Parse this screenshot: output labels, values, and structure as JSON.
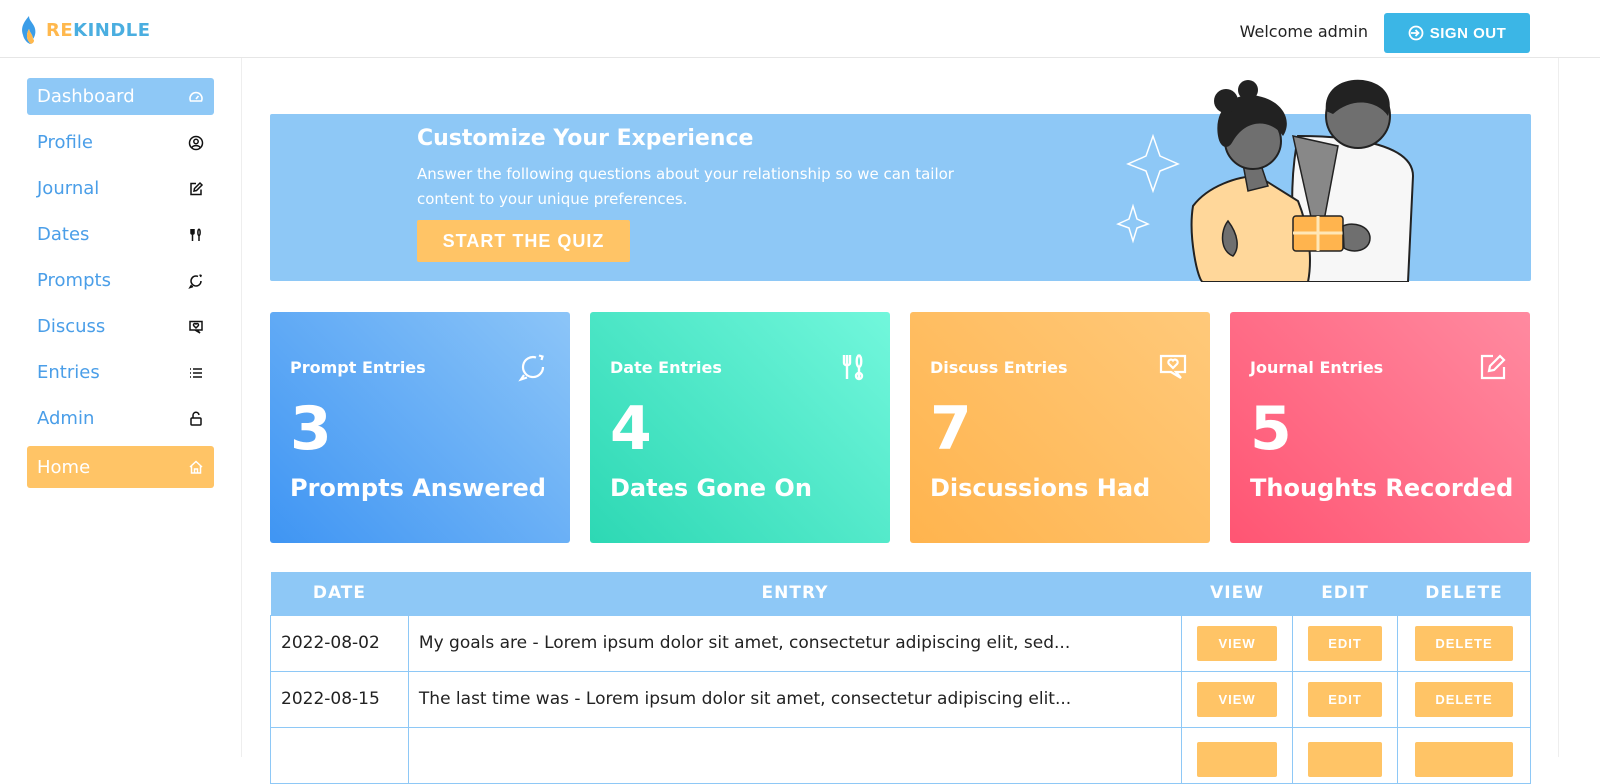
{
  "app": {
    "brand_re": "RE",
    "brand_rest": "KINDLE"
  },
  "header": {
    "welcome": "Welcome admin",
    "signout": "SIGN OUT"
  },
  "sidebar": {
    "items": [
      {
        "label": "Dashboard",
        "icon": "gauge-icon",
        "state": "active"
      },
      {
        "label": "Profile",
        "icon": "user-circle-icon"
      },
      {
        "label": "Journal",
        "icon": "edit-icon"
      },
      {
        "label": "Dates",
        "icon": "utensils-icon"
      },
      {
        "label": "Prompts",
        "icon": "chat-refresh-icon"
      },
      {
        "label": "Discuss",
        "icon": "chat-heart-icon"
      },
      {
        "label": "Entries",
        "icon": "list-icon"
      },
      {
        "label": "Admin",
        "icon": "lock-icon"
      },
      {
        "label": "Home",
        "icon": "home-icon",
        "state": "home"
      }
    ]
  },
  "banner": {
    "title": "Customize Your Experience",
    "text": "Answer the following questions about your relationship so we can tailor content to your unique preferences.",
    "button": "START THE QUIZ"
  },
  "cards": [
    {
      "title": "Prompt Entries",
      "value": "3",
      "subtitle": "Prompts Answered",
      "icon": "chat-refresh-icon"
    },
    {
      "title": "Date Entries",
      "value": "4",
      "subtitle": "Dates Gone On",
      "icon": "utensils-icon"
    },
    {
      "title": "Discuss Entries",
      "value": "7",
      "subtitle": "Discussions Had",
      "icon": "chat-heart-icon"
    },
    {
      "title": "Journal Entries",
      "value": "5",
      "subtitle": "Thoughts Recorded",
      "icon": "edit-icon"
    }
  ],
  "table": {
    "headers": [
      "DATE",
      "ENTRY",
      "VIEW",
      "EDIT",
      "DELETE"
    ],
    "rows": [
      {
        "date": "2022-08-02",
        "entry": "My goals are - Lorem ipsum dolor sit amet, consectetur adipiscing elit, sed...",
        "view": "VIEW",
        "edit": "EDIT",
        "delete": "DELETE"
      },
      {
        "date": "2022-08-15",
        "entry": "The last time was - Lorem ipsum dolor sit amet, consectetur adipiscing elit...",
        "view": "VIEW",
        "edit": "EDIT",
        "delete": "DELETE"
      }
    ]
  },
  "colors": {
    "accent_blue": "#8ec8f6",
    "nav_text": "#4a9ee8",
    "accent_orange": "#ffc466",
    "signout": "#3bb6e6"
  }
}
